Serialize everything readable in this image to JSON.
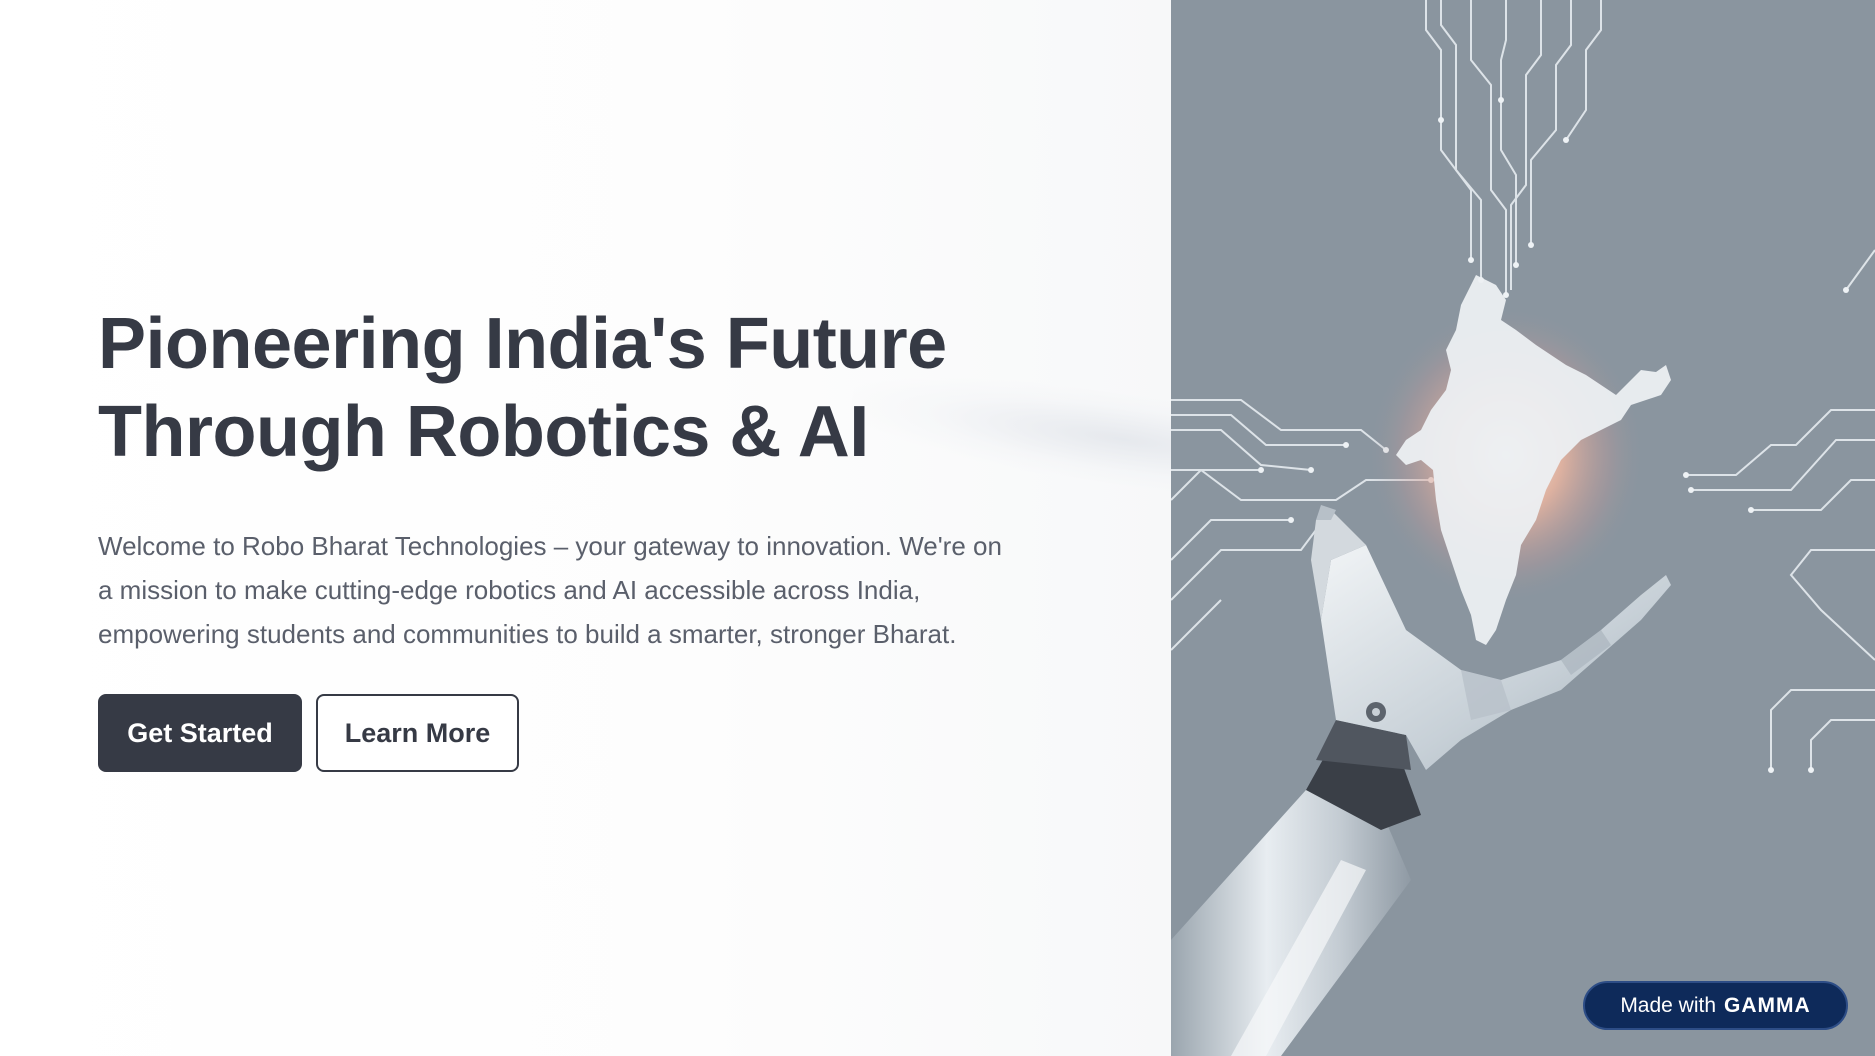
{
  "hero": {
    "headline_line1": "Pioneering India's Future",
    "headline_line2": "Through Robotics & AI",
    "intro_line1": "Welcome to Robo Bharat Technologies – your gateway to innovation. We're on",
    "intro_line2": "a mission to make cutting-edge robotics and AI accessible across India,",
    "intro_line3": "empowering students and communities to build a smarter, stronger Bharat."
  },
  "actions": {
    "primary_label": "Get Started",
    "secondary_label": "Learn More"
  },
  "illustration": {
    "icon": "robot-hand-india-map-illustration",
    "background_color": "#8a959f"
  },
  "badge": {
    "prefix": "Made with",
    "brand": "GAMMA"
  },
  "colors": {
    "text_dark": "#363a45",
    "text_body": "#5a5f6b",
    "badge_bg": "#0e2a5a"
  }
}
